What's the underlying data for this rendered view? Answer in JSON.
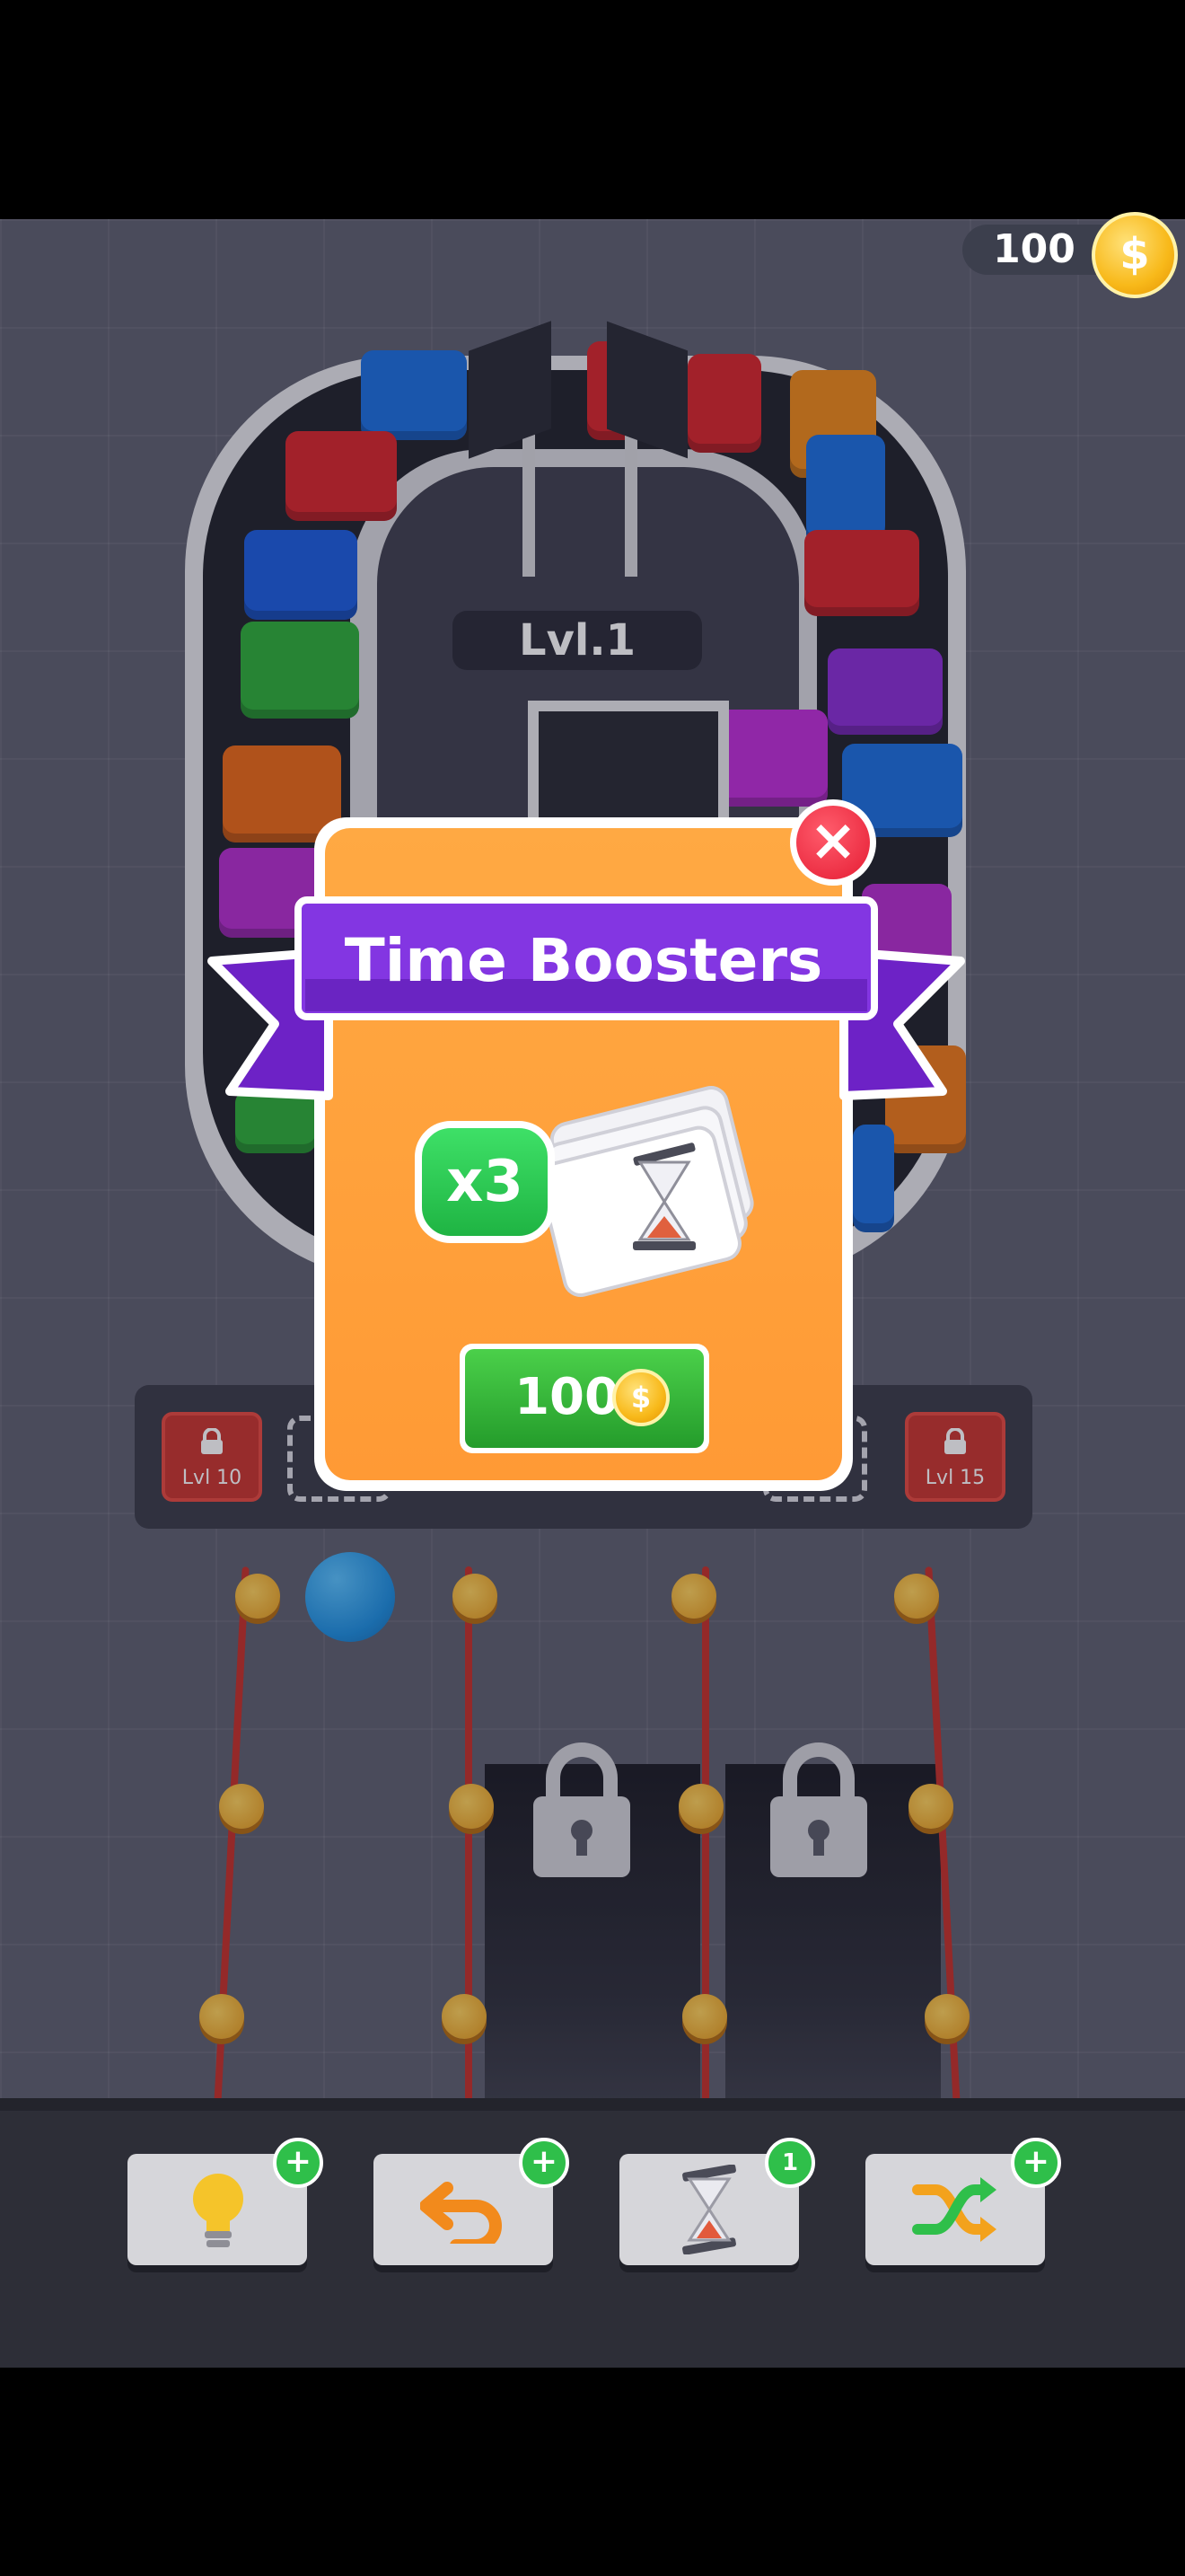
{
  "hud": {
    "coins": "100",
    "coin_icon": "coin-icon"
  },
  "board": {
    "level_label": "Lvl.1"
  },
  "slot_bar": {
    "left_lock_label": "Lvl 10",
    "right_lock_label": "Lvl 15"
  },
  "popup": {
    "title": "Time Boosters",
    "multiplier": "x3",
    "price": "100",
    "close_icon": "close-icon"
  },
  "toolbar": {
    "items": [
      {
        "name": "hint",
        "icon": "lightbulb-icon",
        "badge": "+"
      },
      {
        "name": "undo",
        "icon": "undo-arrow-icon",
        "badge": "+"
      },
      {
        "name": "time",
        "icon": "hourglass-icon",
        "badge": "1"
      },
      {
        "name": "shuffle",
        "icon": "shuffle-icon",
        "badge": "+"
      }
    ]
  },
  "colors": {
    "popup_orange": "#ffa943",
    "ribbon_purple": "#7a2ed8",
    "buy_green": "#2fb83a",
    "close_red": "#e51c33",
    "background_grey": "#5f6070"
  }
}
